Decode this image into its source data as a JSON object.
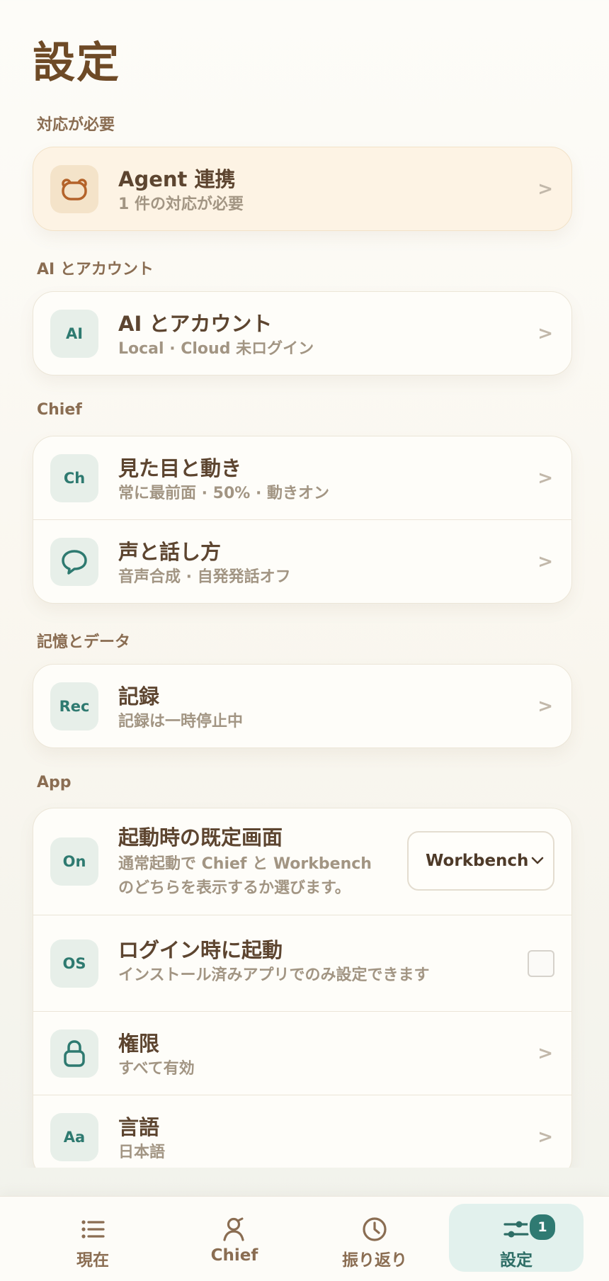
{
  "page_title": "設定",
  "sections": {
    "needs_action": {
      "label": "対応が必要",
      "items": [
        {
          "title": "Agent 連携",
          "subtitle": "1 件の対応が必要",
          "icon": "bear-face-icon",
          "chevron": ">"
        }
      ]
    },
    "ai_account": {
      "label": "AI とアカウント",
      "items": [
        {
          "title": "AI とアカウント",
          "subtitle": "Local · Cloud 未ログイン",
          "icon_text": "AI",
          "chevron": ">"
        }
      ]
    },
    "chief": {
      "label": "Chief",
      "items": [
        {
          "title": "見た目と動き",
          "subtitle": "常に最前面 · 50% · 動きオン",
          "icon_text": "Ch",
          "chevron": ">"
        },
        {
          "title": "声と話し方",
          "subtitle": "音声合成 · 自発発話オフ",
          "icon": "speech-bubble-icon",
          "chevron": ">"
        }
      ]
    },
    "memory_data": {
      "label": "記憶とデータ",
      "items": [
        {
          "title": "記録",
          "subtitle": "記録は一時停止中",
          "icon_text": "Rec",
          "chevron": ">"
        }
      ]
    },
    "app": {
      "label": "App",
      "startup": {
        "title": "起動時の既定画面",
        "subtitle_line1": "通常起動で Chief と Workbench",
        "subtitle_line2": "のどちらを表示するか選びます。",
        "icon_text": "On",
        "selected": "Workbench"
      },
      "login_launch": {
        "title": "ログイン時に起動",
        "subtitle": "インストール済みアプリでのみ設定できます",
        "icon_text": "OS",
        "checked": false
      },
      "permissions": {
        "title": "権限",
        "subtitle": "すべて有効",
        "icon": "lock-icon",
        "chevron": ">"
      },
      "language": {
        "title": "言語",
        "subtitle": "日本語",
        "icon_text": "Aa",
        "chevron": ">"
      }
    }
  },
  "bottom_nav": {
    "items": [
      {
        "label": "現在",
        "icon": "list-icon"
      },
      {
        "label": "Chief",
        "icon": "chief-person-icon"
      },
      {
        "label": "振り返り",
        "icon": "clock-icon"
      },
      {
        "label": "設定",
        "icon": "sliders-icon",
        "badge": "1",
        "active": true
      }
    ]
  },
  "colors": {
    "accent": "#2f7a72",
    "title_brown": "#6e4a26",
    "alert_bg": "#fdf3e4"
  }
}
